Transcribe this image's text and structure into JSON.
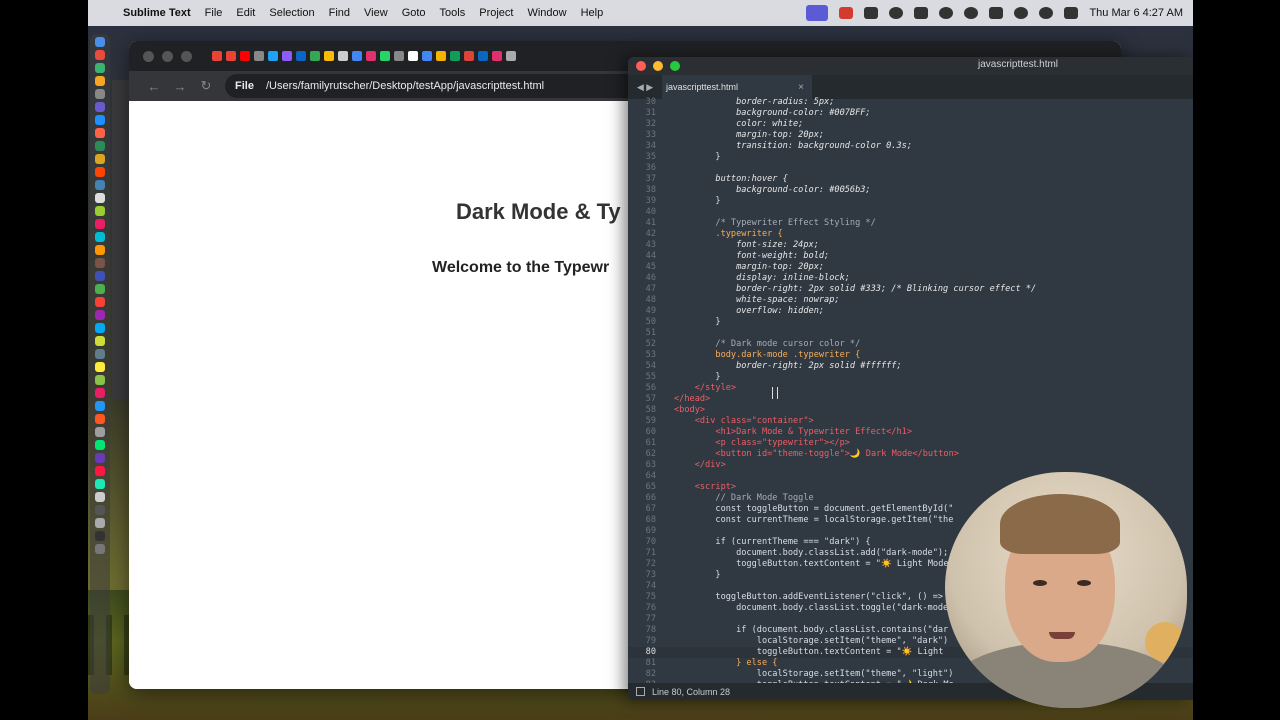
{
  "menubar": {
    "app_name": "Sublime Text",
    "items": [
      "File",
      "Edit",
      "Selection",
      "Find",
      "View",
      "Goto",
      "Tools",
      "Project",
      "Window",
      "Help"
    ],
    "clock": "Thu Mar 6  4:27 AM"
  },
  "browser": {
    "url_chip": "File",
    "url": "/Users/familyrutscher/Desktop/testApp/javascripttest.html",
    "page_title": "Dark Mode & Ty",
    "page_subtitle": "Welcome to the Typewr"
  },
  "editor": {
    "window_title": "javascripttest.html",
    "tab_label": "javascripttest.html",
    "status": "Line 80, Column 28",
    "current_line": 80,
    "lines": [
      {
        "n": "30",
        "t": "            border-radius: 5px;"
      },
      {
        "n": "31",
        "t": "            background-color: #007BFF;"
      },
      {
        "n": "32",
        "t": "            color: white;"
      },
      {
        "n": "33",
        "t": "            margin-top: 20px;"
      },
      {
        "n": "34",
        "t": "            transition: background-color 0.3s;"
      },
      {
        "n": "35",
        "t": "        }"
      },
      {
        "n": "36",
        "t": ""
      },
      {
        "n": "37",
        "t": "        button:hover {"
      },
      {
        "n": "38",
        "t": "            background-color: #0056b3;"
      },
      {
        "n": "39",
        "t": "        }"
      },
      {
        "n": "40",
        "t": ""
      },
      {
        "n": "41",
        "t": "        /* Typewriter Effect Styling */"
      },
      {
        "n": "42",
        "t": "        .typewriter {"
      },
      {
        "n": "43",
        "t": "            font-size: 24px;"
      },
      {
        "n": "44",
        "t": "            font-weight: bold;"
      },
      {
        "n": "45",
        "t": "            margin-top: 20px;"
      },
      {
        "n": "46",
        "t": "            display: inline-block;"
      },
      {
        "n": "47",
        "t": "            border-right: 2px solid #333; /* Blinking cursor effect */"
      },
      {
        "n": "48",
        "t": "            white-space: nowrap;"
      },
      {
        "n": "49",
        "t": "            overflow: hidden;"
      },
      {
        "n": "50",
        "t": "        }"
      },
      {
        "n": "51",
        "t": ""
      },
      {
        "n": "52",
        "t": "        /* Dark mode cursor color */"
      },
      {
        "n": "53",
        "t": "        body.dark-mode .typewriter {"
      },
      {
        "n": "54",
        "t": "            border-right: 2px solid #ffffff;"
      },
      {
        "n": "55",
        "t": "        }"
      },
      {
        "n": "56",
        "t": "    </style>"
      },
      {
        "n": "57",
        "t": "</head>"
      },
      {
        "n": "58",
        "t": "<body>"
      },
      {
        "n": "59",
        "t": "    <div class=\"container\">"
      },
      {
        "n": "60",
        "t": "        <h1>Dark Mode & Typewriter Effect</h1>"
      },
      {
        "n": "61",
        "t": "        <p class=\"typewriter\"></p>"
      },
      {
        "n": "62",
        "t": "        <button id=\"theme-toggle\">🌙 Dark Mode</button>"
      },
      {
        "n": "63",
        "t": "    </div>"
      },
      {
        "n": "64",
        "t": ""
      },
      {
        "n": "65",
        "t": "    <script>"
      },
      {
        "n": "66",
        "t": "        // Dark Mode Toggle"
      },
      {
        "n": "67",
        "t": "        const toggleButton = document.getElementById(\""
      },
      {
        "n": "68",
        "t": "        const currentTheme = localStorage.getItem(\"the"
      },
      {
        "n": "69",
        "t": ""
      },
      {
        "n": "70",
        "t": "        if (currentTheme === \"dark\") {"
      },
      {
        "n": "71",
        "t": "            document.body.classList.add(\"dark-mode\");"
      },
      {
        "n": "72",
        "t": "            toggleButton.textContent = \"☀️ Light Mode"
      },
      {
        "n": "73",
        "t": "        }"
      },
      {
        "n": "74",
        "t": ""
      },
      {
        "n": "75",
        "t": "        toggleButton.addEventListener(\"click\", () =>"
      },
      {
        "n": "76",
        "t": "            document.body.classList.toggle(\"dark-mode"
      },
      {
        "n": "77",
        "t": ""
      },
      {
        "n": "78",
        "t": "            if (document.body.classList.contains(\"dar"
      },
      {
        "n": "79",
        "t": "                localStorage.setItem(\"theme\", \"dark\")"
      },
      {
        "n": "80",
        "t": "                toggleButton.textContent = \"☀️ Light"
      },
      {
        "n": "81",
        "t": "            } else {"
      },
      {
        "n": "82",
        "t": "                localStorage.setItem(\"theme\", \"light\")"
      },
      {
        "n": "83",
        "t": "                toggleButton.textContent = \"🌙 Dark Mo"
      }
    ]
  }
}
